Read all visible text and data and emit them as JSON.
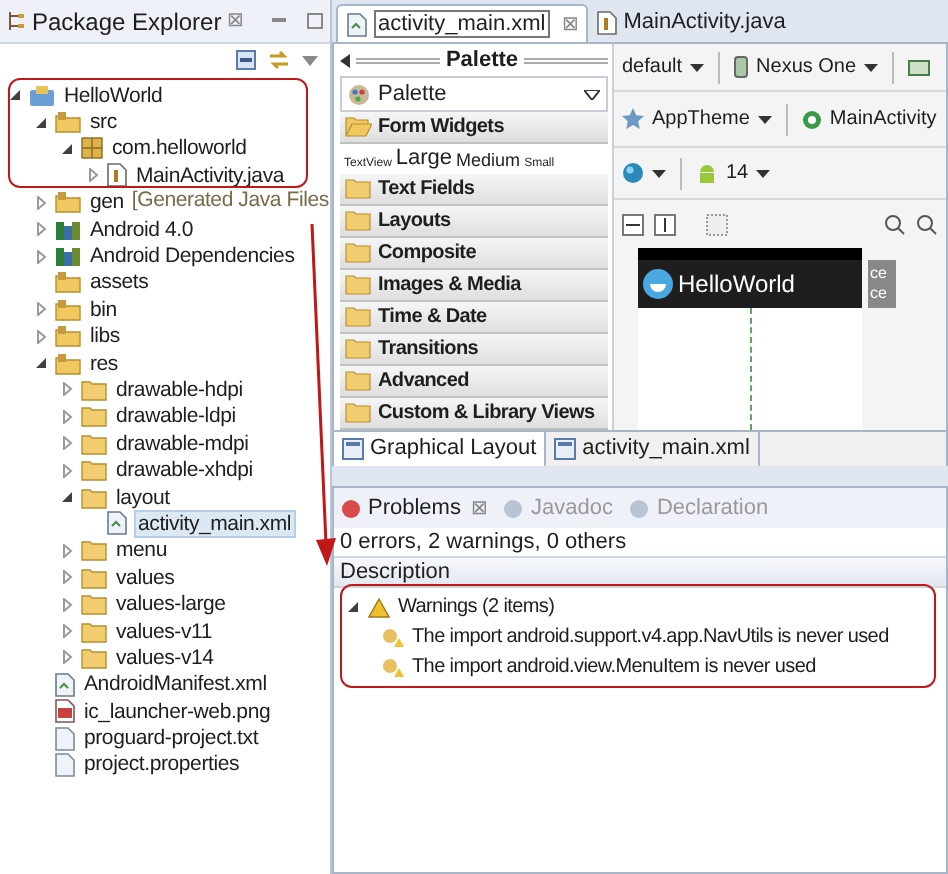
{
  "explorer": {
    "title": "Package Explorer",
    "close": "⊠",
    "tree": [
      {
        "label": "HelloWorld",
        "kind": "project",
        "expanded": true,
        "selected": false,
        "children": [
          {
            "label": "src",
            "kind": "src",
            "expanded": true,
            "selected": false,
            "children": [
              {
                "label": "com.helloworld",
                "kind": "package",
                "expanded": true,
                "selected": false,
                "children": [
                  {
                    "label": "MainActivity.java",
                    "kind": "java",
                    "expanded": false,
                    "selected": false
                  }
                ]
              }
            ]
          },
          {
            "label": "gen",
            "note": "[Generated Java Files",
            "kind": "src",
            "expanded": false,
            "selected": false
          },
          {
            "label": "Android 4.0",
            "kind": "library",
            "expanded": false,
            "selected": false
          },
          {
            "label": "Android Dependencies",
            "kind": "library",
            "expanded": false,
            "selected": false
          },
          {
            "label": "assets",
            "kind": "src",
            "selected": false
          },
          {
            "label": "bin",
            "kind": "src",
            "expanded": false,
            "selected": false
          },
          {
            "label": "libs",
            "kind": "src",
            "expanded": false,
            "selected": false
          },
          {
            "label": "res",
            "kind": "src",
            "expanded": true,
            "selected": false,
            "children": [
              {
                "label": "drawable-hdpi",
                "kind": "folder",
                "expanded": false,
                "selected": false
              },
              {
                "label": "drawable-ldpi",
                "kind": "folder",
                "expanded": false,
                "selected": false
              },
              {
                "label": "drawable-mdpi",
                "kind": "folder",
                "expanded": false,
                "selected": false
              },
              {
                "label": "drawable-xhdpi",
                "kind": "folder",
                "expanded": false,
                "selected": false
              },
              {
                "label": "layout",
                "kind": "folder",
                "expanded": true,
                "selected": false,
                "children": [
                  {
                    "label": "activity_main.xml",
                    "kind": "xml",
                    "selected": true
                  }
                ]
              },
              {
                "label": "menu",
                "kind": "folder",
                "expanded": false,
                "selected": false
              },
              {
                "label": "values",
                "kind": "folder",
                "expanded": false,
                "selected": false
              },
              {
                "label": "values-large",
                "kind": "folder",
                "expanded": false,
                "selected": false
              },
              {
                "label": "values-v11",
                "kind": "folder",
                "expanded": false,
                "selected": false
              },
              {
                "label": "values-v14",
                "kind": "folder",
                "expanded": false,
                "selected": false
              }
            ]
          },
          {
            "label": "AndroidManifest.xml",
            "kind": "xml",
            "selected": false
          },
          {
            "label": "ic_launcher-web.png",
            "kind": "image",
            "selected": false
          },
          {
            "label": "proguard-project.txt",
            "kind": "text",
            "selected": false
          },
          {
            "label": "project.properties",
            "kind": "text",
            "selected": false
          }
        ]
      }
    ]
  },
  "editor_tabs": [
    {
      "label": "activity_main.xml",
      "kind": "xml",
      "selected": true,
      "close": "⊠"
    },
    {
      "label": "MainActivity.java",
      "kind": "java",
      "selected": false
    }
  ],
  "palette": {
    "title": "Palette",
    "dropdown": "Palette",
    "categories": [
      {
        "label": "Form Widgets",
        "expanded": true,
        "preview": [
          {
            "label": "TextView",
            "kind": "tiny"
          },
          {
            "label": "Large",
            "kind": "large"
          },
          {
            "label": "Medium",
            "kind": "medium"
          },
          {
            "label": "Small",
            "kind": "tiny"
          }
        ]
      },
      {
        "label": "Text Fields",
        "expanded": false
      },
      {
        "label": "Layouts",
        "expanded": false
      },
      {
        "label": "Composite",
        "expanded": false
      },
      {
        "label": "Images & Media",
        "expanded": false
      },
      {
        "label": "Time & Date",
        "expanded": false
      },
      {
        "label": "Transitions",
        "expanded": false
      },
      {
        "label": "Advanced",
        "expanded": false
      },
      {
        "label": "Custom & Library Views",
        "expanded": false
      }
    ]
  },
  "canvas": {
    "config": "default",
    "device": "Nexus One",
    "theme": "AppTheme",
    "activity": "MainActivity",
    "api": "14",
    "app_title": "HelloWorld",
    "side": [
      "ce",
      "ce"
    ]
  },
  "bottom_tabs": [
    {
      "label": "Graphical Layout",
      "selected": true
    },
    {
      "label": "activity_main.xml",
      "selected": false
    }
  ],
  "problems": {
    "tabs": [
      {
        "label": "Problems",
        "selected": true,
        "close": "⊠"
      },
      {
        "label": "Javadoc",
        "selected": false
      },
      {
        "label": "Declaration",
        "selected": false
      }
    ],
    "summary": "0 errors, 2 warnings, 0 others",
    "column": "Description",
    "group": {
      "label": "Warnings (2 items)",
      "expanded": true,
      "items": [
        "The import android.support.v4.app.NavUtils is never used",
        "The import android.view.MenuItem is never used"
      ]
    }
  }
}
